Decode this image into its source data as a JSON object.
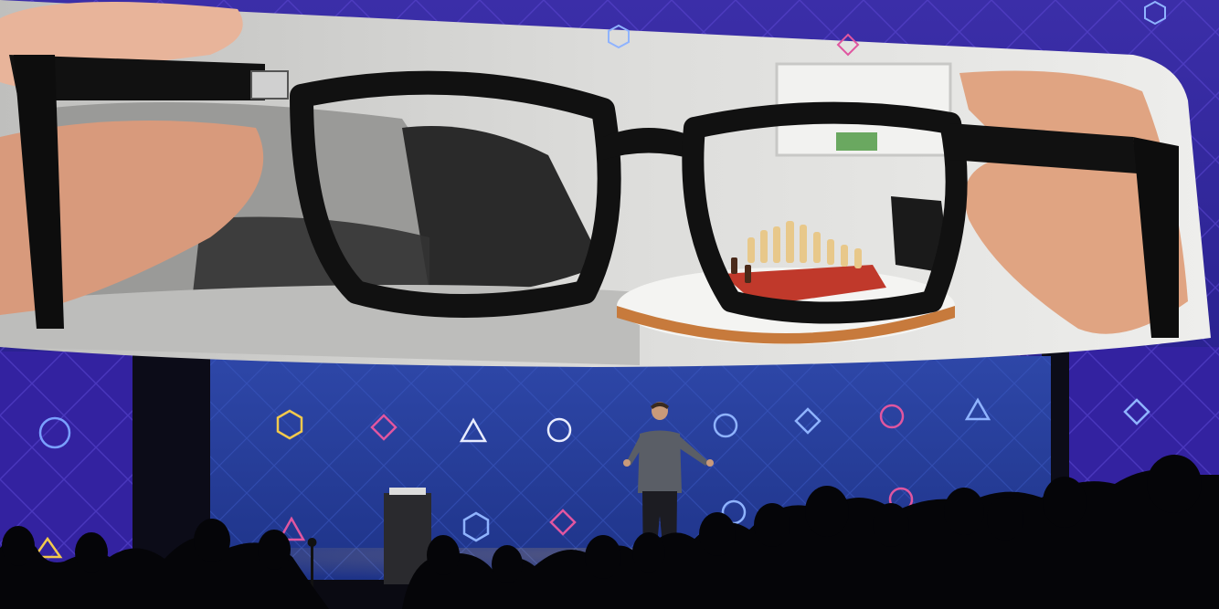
{
  "scene": {
    "description_free": true,
    "colors": {
      "stage_blue": "#2a3f9e",
      "side_purple": "#3a2a9a",
      "screen_light": "#d8d8d6",
      "frame_black": "#111111",
      "chessboard_red": "#c0392b",
      "table_wood": "#c77a3c",
      "audience": "#050508",
      "hex_yellow": "#f2c94c",
      "diamond_pink": "#e056a0",
      "shape_white": "#e8ecff",
      "circle_blue": "#8fb3ff"
    },
    "icons": [
      "hexagon-icon",
      "diamond-icon",
      "triangle-icon",
      "circle-icon"
    ]
  }
}
